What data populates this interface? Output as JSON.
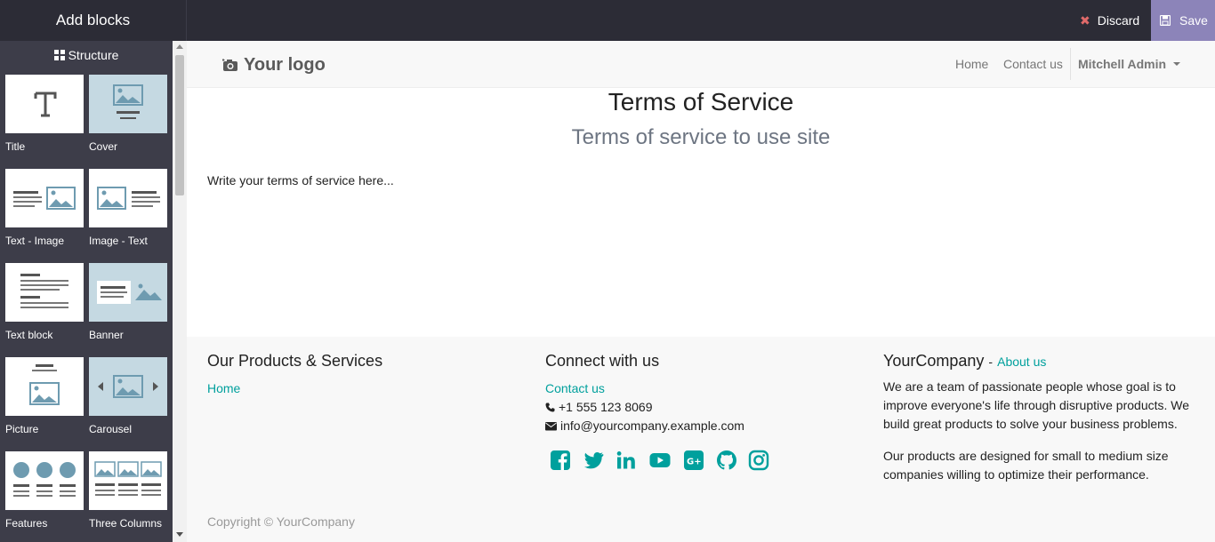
{
  "editor": {
    "panel_title": "Add blocks",
    "discard_label": "Discard",
    "save_label": "Save"
  },
  "sidebar": {
    "section_label": "Structure",
    "blocks": [
      {
        "label": "Title"
      },
      {
        "label": "Cover"
      },
      {
        "label": "Text - Image"
      },
      {
        "label": "Image - Text"
      },
      {
        "label": "Text block"
      },
      {
        "label": "Banner"
      },
      {
        "label": "Picture"
      },
      {
        "label": "Carousel"
      },
      {
        "label": "Features"
      },
      {
        "label": "Three Columns"
      }
    ]
  },
  "navbar": {
    "logo_text": "Your logo",
    "links": [
      {
        "label": "Home"
      },
      {
        "label": "Contact us"
      }
    ],
    "user": "Mitchell Admin"
  },
  "page": {
    "title": "Terms of Service",
    "subtitle": "Terms of service to use site",
    "body": "Write your terms of service here..."
  },
  "footer": {
    "col1": {
      "heading": "Our Products & Services",
      "link": "Home"
    },
    "col2": {
      "heading": "Connect with us",
      "link": "Contact us",
      "phone": "+1 555 123 8069",
      "email": "info@yourcompany.example.com",
      "social_icons": [
        "facebook-icon",
        "twitter-icon",
        "linkedin-icon",
        "youtube-icon",
        "google-plus-icon",
        "github-icon",
        "instagram-icon"
      ]
    },
    "col3": {
      "company": "YourCompany",
      "separator": "-",
      "about_link": "About us",
      "para1": "We are a team of passionate people whose goal is to improve everyone's life through disruptive products. We build great products to solve your business problems.",
      "para2": "Our products are designed for small to medium size companies willing to optimize their performance."
    },
    "copyright": "Copyright © YourCompany"
  },
  "colors": {
    "topbar": "#2c2c36",
    "sidebar": "#3d3d49",
    "save_button": "#8c84b9",
    "accent": "#00a09d",
    "discard_icon": "#e06a6a"
  }
}
